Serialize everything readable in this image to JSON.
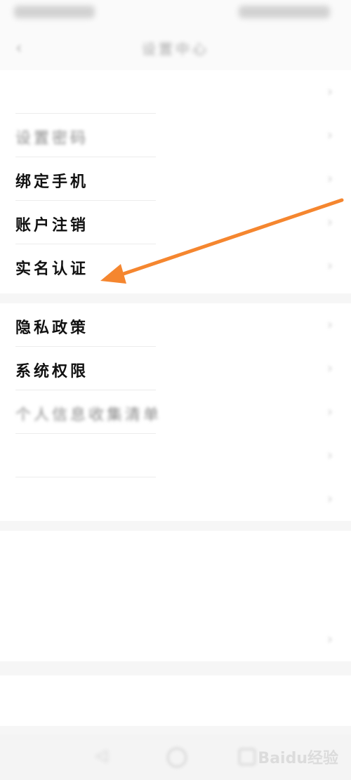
{
  "header": {
    "title": "设置中心"
  },
  "group1": {
    "items": [
      {
        "label": "",
        "value": ""
      },
      {
        "label": "设置密码",
        "value": ""
      },
      {
        "label": "绑定手机",
        "value": ""
      },
      {
        "label": "账户注销",
        "value": ""
      },
      {
        "label": "实名认证",
        "value": ""
      }
    ]
  },
  "group2": {
    "items": [
      {
        "label": "隐私政策"
      },
      {
        "label": "系统权限"
      },
      {
        "label": "个人信息收集清单"
      },
      {
        "label": ""
      },
      {
        "label": ""
      }
    ]
  },
  "group3": {
    "items": [
      {
        "label": ""
      },
      {
        "label": ""
      },
      {
        "label": ""
      }
    ]
  },
  "bottom_action": {
    "label": ""
  },
  "watermark": {
    "text": "Baidu经验"
  },
  "colors": {
    "arrow": "#f5862f",
    "accent_blue": "#7a9bdc"
  },
  "icons": [
    "back-icon",
    "chevron-right-icon",
    "nav-back-icon",
    "nav-home-icon",
    "nav-recent-icon"
  ]
}
